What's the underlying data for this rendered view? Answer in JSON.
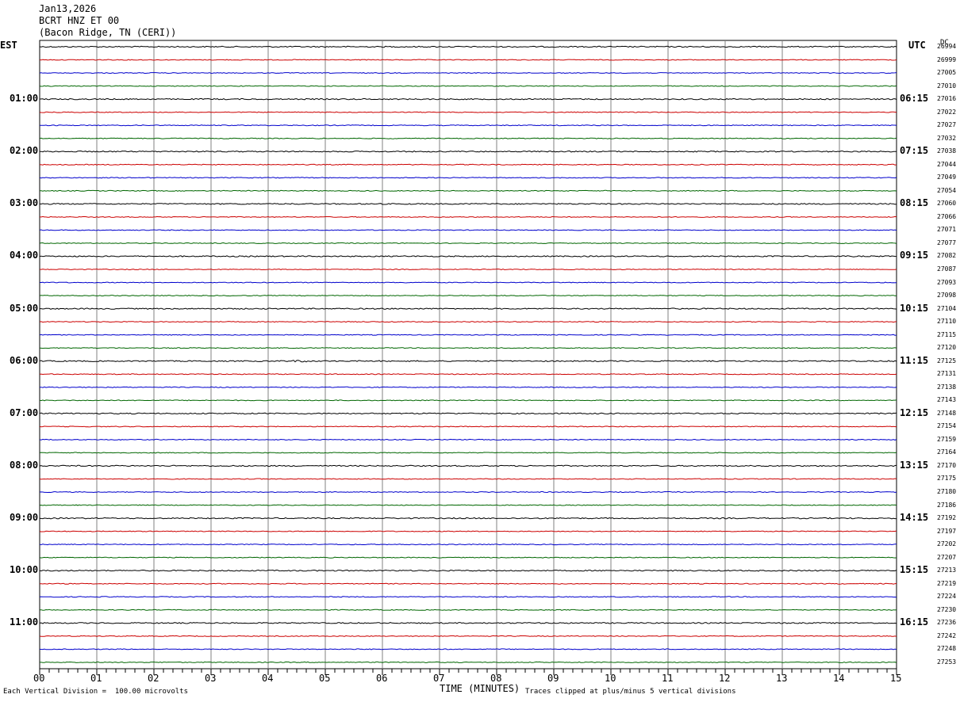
{
  "header": {
    "date": "Jan13,2026",
    "station": "BCRT HNZ ET 00",
    "location": "(Bacon Ridge, TN (CERI))"
  },
  "labels": {
    "left_tz": "EST",
    "right_tz": "UTC",
    "dc_header": "DC",
    "x_title": "TIME (MINUTES)",
    "vertical_division": "Each Vertical Division =  100.00 microvolts",
    "clip_note": "Traces clipped at plus/minus 5 vertical divisions"
  },
  "colors": {
    "trace_cycle": [
      "#000000",
      "#cc0000",
      "#0000cc",
      "#006600"
    ],
    "grid": "#808080"
  },
  "chart_data": {
    "type": "line",
    "title": "BCRT HNZ ET 00",
    "xlabel": "TIME (MINUTES)",
    "xlim": [
      0,
      15
    ],
    "x_ticks": [
      "00",
      "01",
      "02",
      "03",
      "04",
      "05",
      "06",
      "07",
      "08",
      "09",
      "10",
      "11",
      "12",
      "13",
      "14",
      "15"
    ],
    "left_hour_labels": [
      "01:00",
      "02:00",
      "03:00",
      "04:00",
      "05:00",
      "06:00",
      "07:00",
      "08:00",
      "09:00",
      "10:00",
      "11:00"
    ],
    "right_hour_labels": [
      "06:15",
      "07:15",
      "08:15",
      "09:15",
      "10:15",
      "11:15",
      "12:15",
      "13:15",
      "14:15",
      "15:15",
      "16:15"
    ],
    "trace_count": 48,
    "dc_values": [
      "26994",
      "26999",
      "27005",
      "27010",
      "27016",
      "27022",
      "27027",
      "27032",
      "27038",
      "27044",
      "27049",
      "27054",
      "27060",
      "27066",
      "27071",
      "27077",
      "27082",
      "27087",
      "27093",
      "27098",
      "27104",
      "27110",
      "27115",
      "27120",
      "27125",
      "27131",
      "27138",
      "27143",
      "27148",
      "27154",
      "27159",
      "27164",
      "27170",
      "27175",
      "27180",
      "27186",
      "27192",
      "27197",
      "27202",
      "27207",
      "27213",
      "27219",
      "27224",
      "27230",
      "27236",
      "27242",
      "27248",
      "27253"
    ]
  }
}
